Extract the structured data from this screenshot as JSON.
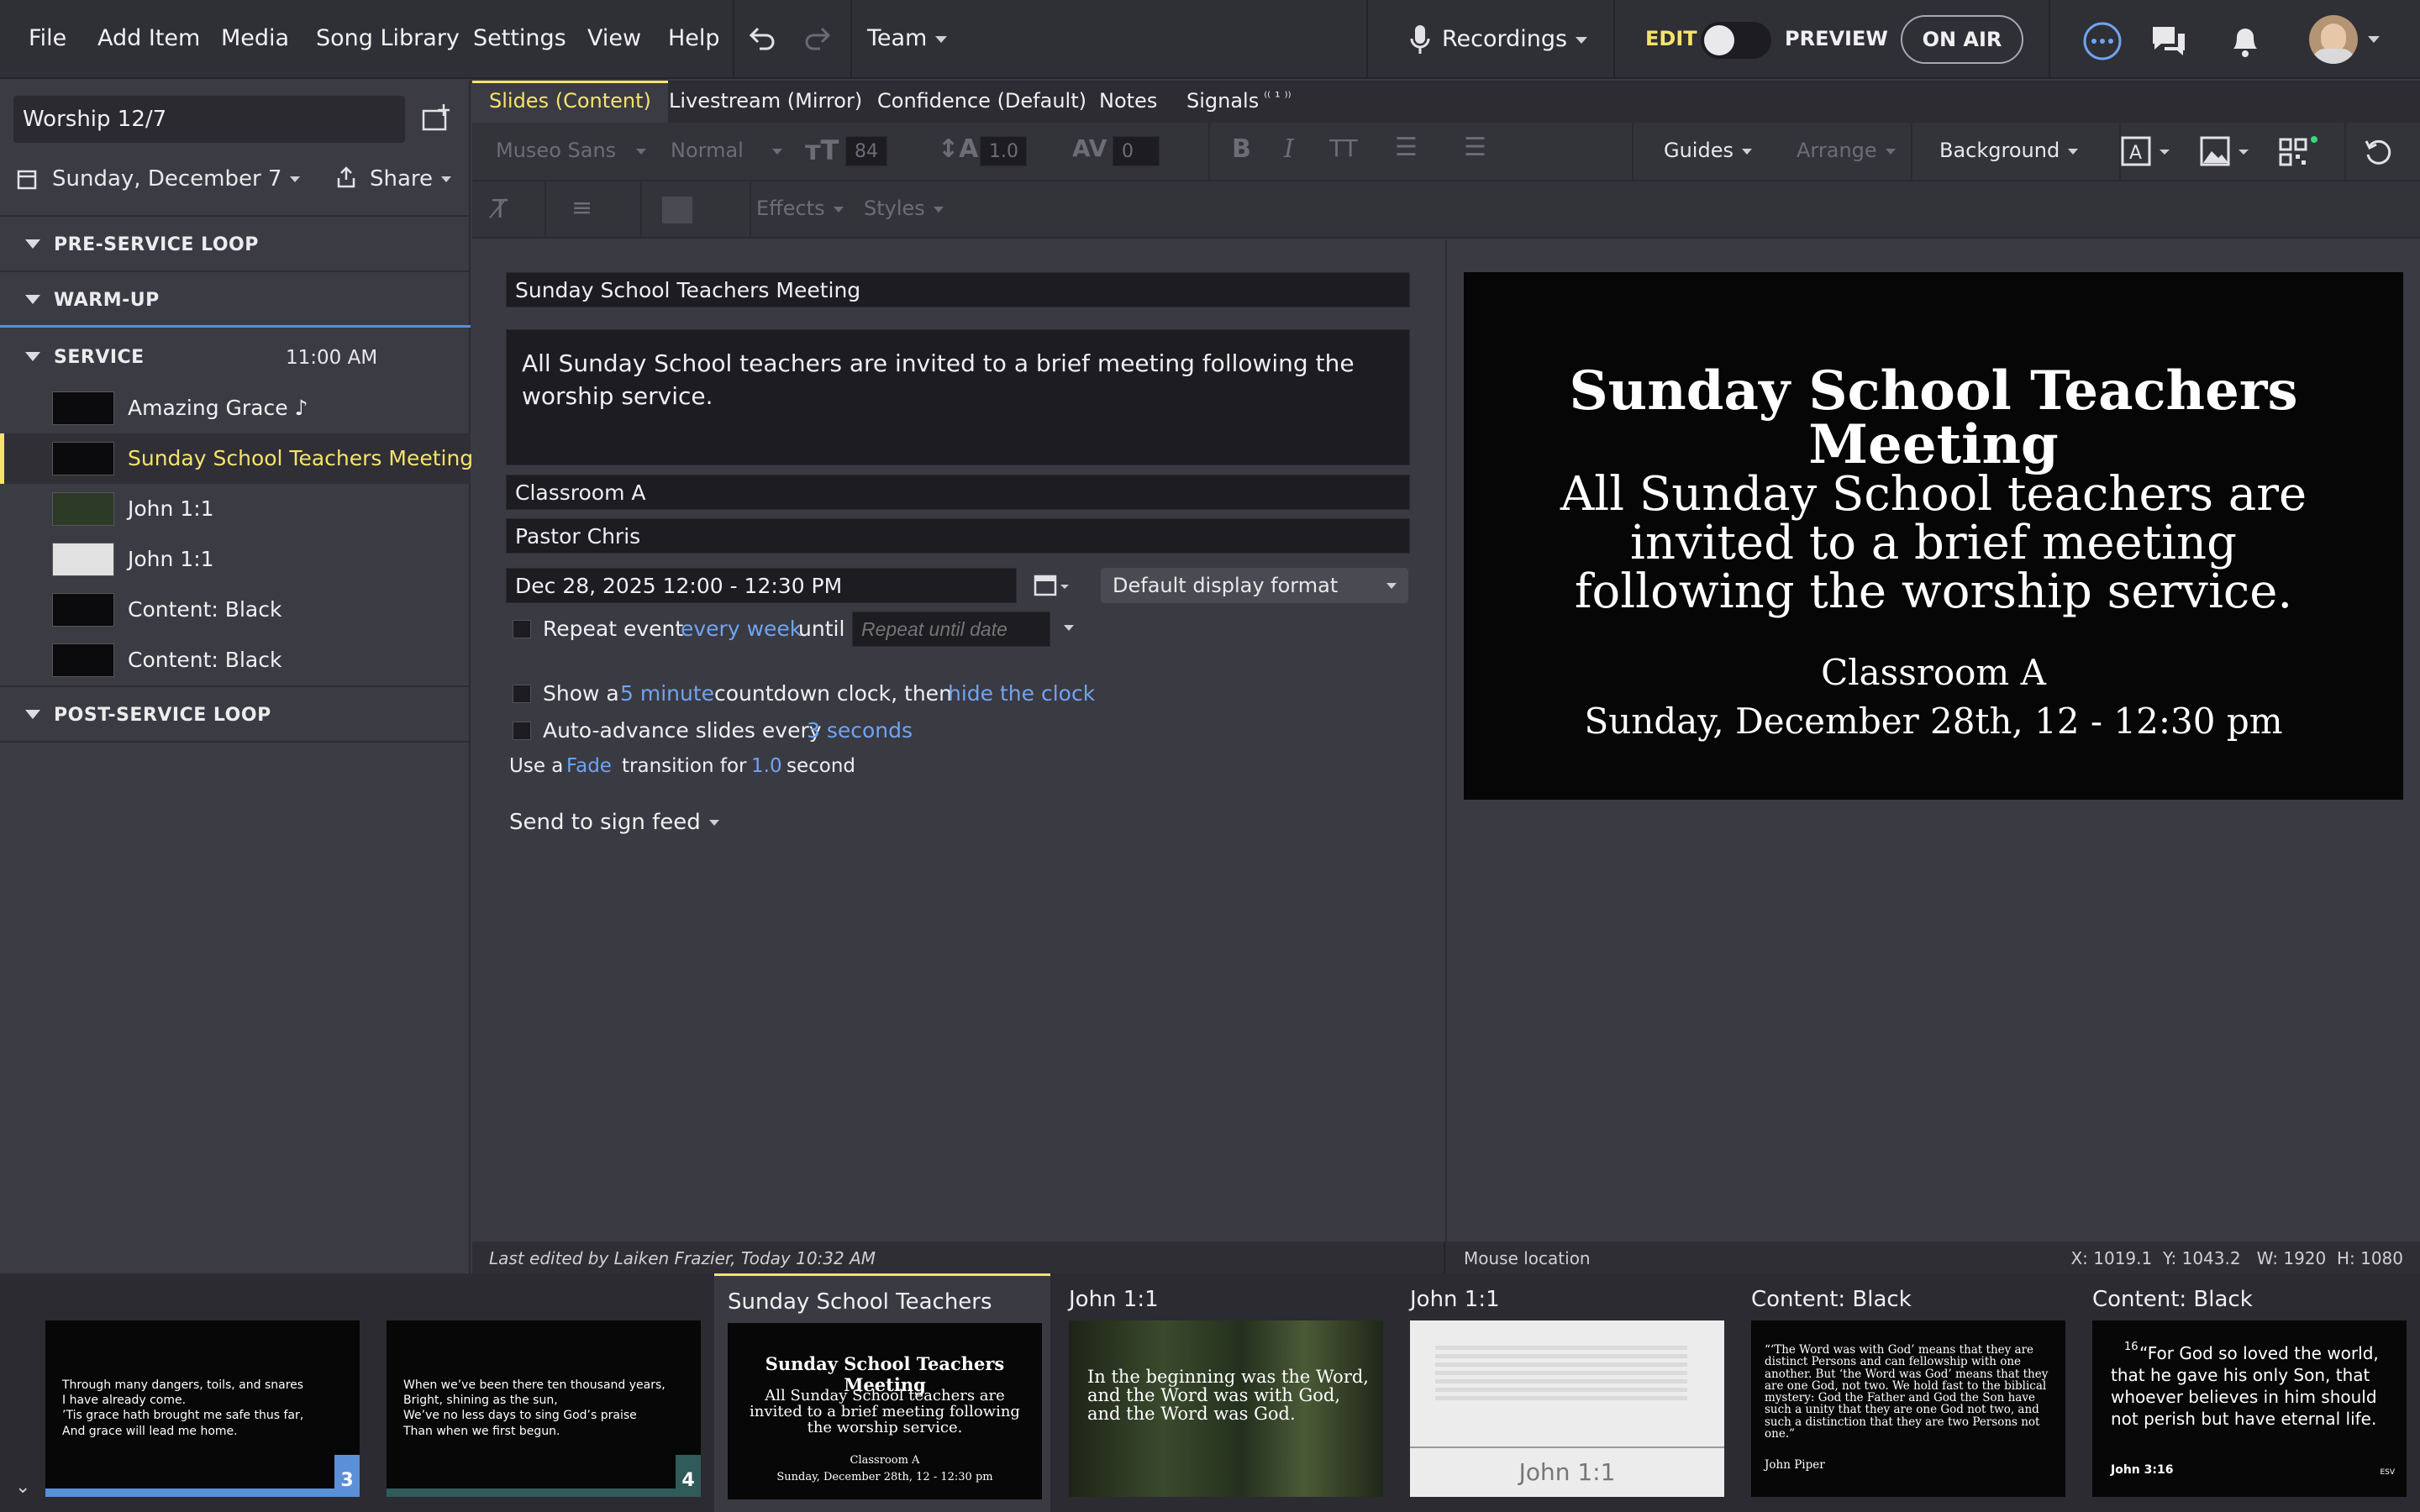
{
  "menu": {
    "file": "File",
    "add_item": "Add Item",
    "media": "Media",
    "song_library": "Song Library",
    "settings": "Settings",
    "view": "View",
    "help": "Help",
    "team": "Team",
    "recordings": "Recordings",
    "edit": "EDIT",
    "preview": "PREVIEW",
    "on_air": "ON AIR"
  },
  "sidebar": {
    "plan_name": "Worship 12/7",
    "date": "Sunday, December 7",
    "share": "Share",
    "sections": [
      {
        "label": "PRE-SERVICE LOOP"
      },
      {
        "label": "WARM-UP"
      },
      {
        "label": "SERVICE",
        "time": "11:00 AM"
      },
      {
        "label": "POST-SERVICE LOOP"
      }
    ],
    "items": [
      {
        "label": "Amazing Grace ♪"
      },
      {
        "label": "Sunday School Teachers Meeting"
      },
      {
        "label": "John 1:1"
      },
      {
        "label": "John 1:1"
      },
      {
        "label": "Content: Black"
      },
      {
        "label": "Content: Black"
      }
    ]
  },
  "tabs": [
    {
      "label": "Slides (Content)"
    },
    {
      "label": "Livestream (Mirror)"
    },
    {
      "label": "Confidence (Default)"
    },
    {
      "label": "Notes"
    },
    {
      "label": "Signals"
    }
  ],
  "signals_badge": "⁽⁽ ¹ ⁾⁾",
  "toolbar": {
    "font": "Museo Sans",
    "weight": "Normal",
    "size": "84",
    "line_height": "1.0",
    "spacing": "0",
    "guides": "Guides",
    "arrange": "Arrange",
    "background": "Background",
    "effects": "Effects",
    "styles": "Styles"
  },
  "editor": {
    "title": "Sunday School Teachers Meeting",
    "body": "All Sunday School teachers are invited to a brief meeting following the worship service.",
    "location": "Classroom A",
    "presenter": "Pastor Chris",
    "datetime": "Dec 28, 2025 12:00 - 12:30 PM",
    "display_format": "Default display format",
    "repeat_label": "Repeat event",
    "repeat_freq": "every week",
    "repeat_until_word": "until",
    "repeat_until_placeholder": "Repeat until date",
    "countdown_pre": "Show a",
    "countdown_amt": "5 minute",
    "countdown_mid": "countdown clock, then",
    "countdown_action": "hide the clock",
    "advance_pre": "Auto-advance slides every",
    "advance_amt": "3 seconds",
    "trans_pre": "Use a",
    "trans_type": "Fade",
    "trans_mid": "transition for",
    "trans_amt": "1.0",
    "trans_post": "second",
    "sign_feed": "Send to sign feed"
  },
  "preview": {
    "title": "Sunday School Teachers Meeting",
    "body": "All Sunday School teachers are invited to a brief meeting following the worship service.",
    "location": "Classroom A",
    "when": "Sunday, December 28th, 12 - 12:30 pm"
  },
  "status": {
    "last_edited": "Last edited by Laiken Frazier, Today 10:32 AM",
    "mouse": "Mouse location",
    "coords": "X: 1019.1  Y: 1043.2   W: 1920  H: 1080"
  },
  "filmstrip": [
    {
      "title": "",
      "text": "Through many dangers, toils, and snares\nI have already come.\n’Tis grace hath brought me safe thus far,\nAnd grace will lead me home.",
      "num": "3"
    },
    {
      "title": "",
      "text": "When we’ve been there ten thousand years,\nBright, shining as the sun,\nWe’ve no less days to sing God’s praise\nThan when we first begun.",
      "num": "4"
    },
    {
      "title": "Sunday School Teachers",
      "h": "Sunday School Teachers Meeting",
      "b": "All Sunday School teachers are invited to a brief meeting following the worship service.",
      "l": "Classroom A",
      "d": "Sunday, December 28th, 12 - 12:30 pm"
    },
    {
      "title": "John 1:1",
      "text": "In the beginning was the Word, and the Word was with God, and the Word was God."
    },
    {
      "title": "John 1:1",
      "ref": "John 1:1"
    },
    {
      "title": "Content: Black",
      "text": "“‘The Word was with God’ means that they are distinct Persons and can fellowship with one another. But ‘the Word was God’ means that they are one God, not two. We hold fast to the biblical mystery: God the Father and God the Son have such a unity that they are one God not two, and such a distinction that they are two Persons not one.”",
      "author": "John Piper"
    },
    {
      "title": "Content: Black",
      "verse_num": "16",
      "text": "“For God so loved the world, that he gave his only Son, that whoever believes in him should not perish but have eternal life.",
      "ref": "John 3:16",
      "ver": "ESV"
    }
  ],
  "colors": {
    "accent": "#f6e36a",
    "link": "#6fa4f2",
    "bg": "#3a3a42"
  }
}
